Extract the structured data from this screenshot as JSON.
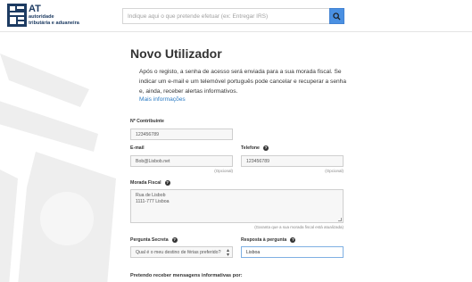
{
  "header": {
    "brand_short": "AT",
    "brand_line1": "autoridade",
    "brand_line2": "tributária e aduaneira",
    "search_placeholder": "Indique aqui o que pretende efetuar (ex: Entregar IRS)",
    "search_icon": "search-icon"
  },
  "page": {
    "title": "Novo Utilizador",
    "intro": "Após o registo, a senha de acesso será enviada para a sua morada fiscal. Se indicar um e-mail e um telemóvel português pode cancelar e recuperar a senha e, ainda, receber alertas informativos.",
    "more_link": "Mais informações"
  },
  "form": {
    "nif_label": "Nº Contribuinte",
    "nif_value": "123456789",
    "email_label": "E-mail",
    "email_value": "Bob@Lisbob.net",
    "email_note": "(Opcional)",
    "phone_label": "Telefone",
    "phone_value": "123456789",
    "phone_note": "(Opcional)",
    "address_label": "Morada Fiscal",
    "address_value": "Rua de Lisbob\n1111-777 Lisboa",
    "address_note": "(Garanta que a sua morada fiscal está atualizada)",
    "question_label": "Pergunta Secreta",
    "question_value": "Qual é o meu destino de férias preferido?",
    "answer_label": "Resposta à pergunta",
    "answer_value": "Lisboa",
    "messages_label": "Pretendo receber mensagens informativas por:"
  },
  "colors": {
    "brand": "#1d3b62",
    "search_button": "#4a90e2",
    "link": "#2b7bc4"
  }
}
